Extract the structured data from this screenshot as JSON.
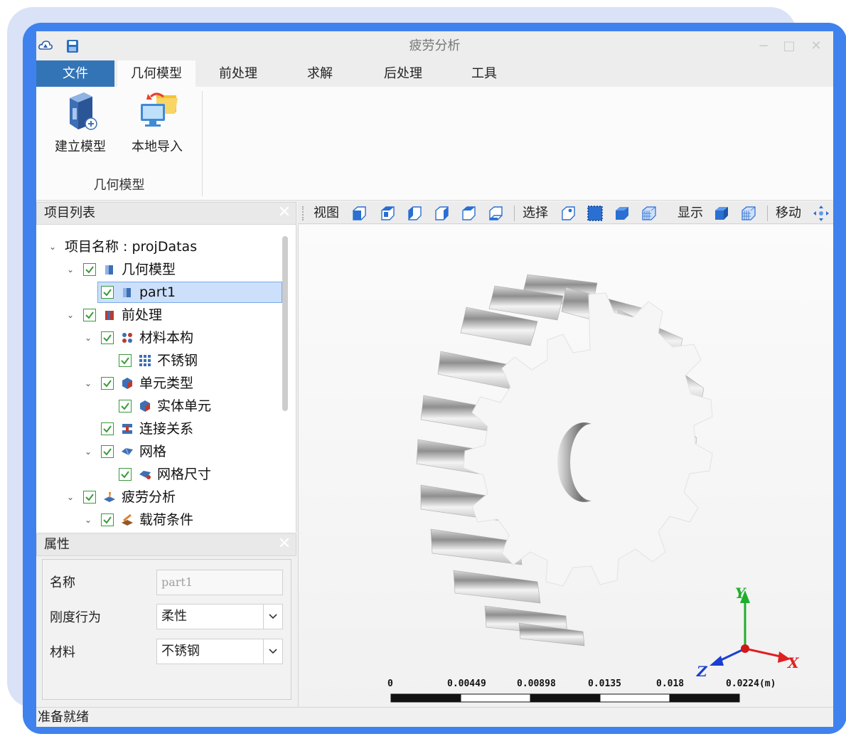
{
  "window": {
    "title": "疲劳分析"
  },
  "tabs": [
    "文件",
    "几何模型",
    "前处理",
    "求解",
    "后处理",
    "工具"
  ],
  "ribbon": {
    "buttons": [
      {
        "label": "建立模型",
        "icon": "create-model-icon"
      },
      {
        "label": "本地导入",
        "icon": "local-import-icon"
      }
    ],
    "group_label": "几何模型"
  },
  "project_panel": {
    "title": "项目列表",
    "root": "项目名称 : projDatas",
    "nodes": [
      {
        "label": "几何模型",
        "icon": "geometry-icon",
        "checked": true,
        "expanded": true
      },
      {
        "label": "part1",
        "icon": "part-icon",
        "checked": true,
        "selected": true
      },
      {
        "label": "前处理",
        "icon": "preprocess-icon",
        "checked": true,
        "expanded": true
      },
      {
        "label": "材料本构",
        "icon": "material-icon",
        "checked": true,
        "expanded": true
      },
      {
        "label": "不锈钢",
        "icon": "grid-material-icon",
        "checked": true
      },
      {
        "label": "单元类型",
        "icon": "element-type-icon",
        "checked": true,
        "expanded": true
      },
      {
        "label": "实体单元",
        "icon": "solid-element-icon",
        "checked": true
      },
      {
        "label": "连接关系",
        "icon": "connection-icon",
        "checked": true
      },
      {
        "label": "网格",
        "icon": "mesh-icon",
        "checked": true,
        "expanded": true
      },
      {
        "label": "网格尺寸",
        "icon": "mesh-size-icon",
        "checked": true
      },
      {
        "label": "疲劳分析",
        "icon": "fatigue-icon",
        "checked": true,
        "expanded": true
      },
      {
        "label": "载荷条件",
        "icon": "load-icon",
        "checked": true,
        "expanded": true
      }
    ]
  },
  "properties": {
    "title": "属性",
    "name_label": "名称",
    "name_value": "part1",
    "stiffness_label": "刚度行为",
    "stiffness_value": "柔性",
    "material_label": "材料",
    "material_value": "不锈钢"
  },
  "viewer_toolbar": {
    "view_label": "视图",
    "select_label": "选择",
    "display_label": "显示",
    "move_label": "移动"
  },
  "scale": {
    "ticks": [
      "0",
      "0.00449",
      "0.00898",
      "0.0135",
      "0.018",
      "0.0224(m)"
    ]
  },
  "axes": {
    "x": "X",
    "y": "Y",
    "z": "Z"
  },
  "status": "准备就绪",
  "colors": {
    "accent": "#3f82ee",
    "file_tab": "#3374b6",
    "selection": "#cce0fb"
  }
}
